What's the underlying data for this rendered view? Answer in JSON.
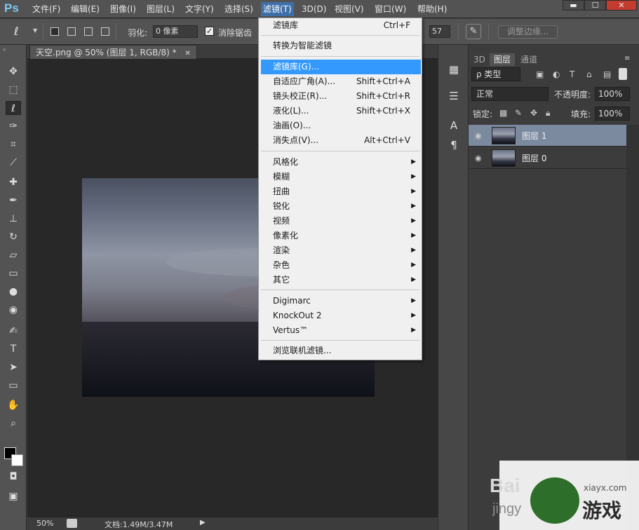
{
  "app": {
    "logo": "Ps"
  },
  "menubar": {
    "items": [
      "文件(F)",
      "编辑(E)",
      "图像(I)",
      "图层(L)",
      "文字(Y)",
      "选择(S)",
      "滤镜(T)",
      "3D(D)",
      "视图(V)",
      "窗口(W)",
      "帮助(H)"
    ],
    "window_buttons": {
      "minimize": "▬",
      "restore": "☐",
      "close": "✕"
    }
  },
  "options": {
    "feather_label": "羽化:",
    "feather_value": "0 像素",
    "antialias_label": "消除锯齿",
    "width_value": "57",
    "refine_edge_label": "调整边缘..."
  },
  "document": {
    "tab_title": "天空.png @ 50% (图层 1, RGB/8) *",
    "tab_close": "✕",
    "zoom": "50%",
    "doc_info": "文档:1.49M/3.47M"
  },
  "filter_menu": {
    "group1": [
      {
        "label": "滤镜库",
        "shortcut": "Ctrl+F"
      }
    ],
    "group2": [
      {
        "label": "转换为智能滤镜",
        "shortcut": ""
      }
    ],
    "group3": [
      {
        "label": "滤镜库(G)...",
        "shortcut": "",
        "highlighted": true
      },
      {
        "label": "自适应广角(A)...",
        "shortcut": "Shift+Ctrl+A"
      },
      {
        "label": "镜头校正(R)...",
        "shortcut": "Shift+Ctrl+R"
      },
      {
        "label": "液化(L)...",
        "shortcut": "Shift+Ctrl+X"
      },
      {
        "label": "油画(O)...",
        "shortcut": ""
      },
      {
        "label": "消失点(V)...",
        "shortcut": "Alt+Ctrl+V"
      }
    ],
    "group4": [
      "风格化",
      "模糊",
      "扭曲",
      "锐化",
      "视频",
      "像素化",
      "渲染",
      "杂色",
      "其它"
    ],
    "group5": [
      "Digimarc",
      "KnockOut 2",
      "Vertus™"
    ],
    "group6": [
      {
        "label": "浏览联机滤镜...",
        "shortcut": ""
      }
    ]
  },
  "layers_panel": {
    "tabs": [
      "3D",
      "图层",
      "通道"
    ],
    "active_tab": "图层",
    "filter_kind": "ρ 类型",
    "blend_mode": "正常",
    "opacity_label": "不透明度:",
    "opacity_value": "100%",
    "lock_label": "锁定:",
    "fill_label": "填充:",
    "fill_value": "100%",
    "layers": [
      {
        "name": "图层 1",
        "selected": true
      },
      {
        "name": "图层 0",
        "selected": false
      }
    ]
  },
  "watermark": {
    "baidu": "Bai",
    "jingyan": "jingy",
    "site": "xiayx.com",
    "game_text": "游戏"
  }
}
